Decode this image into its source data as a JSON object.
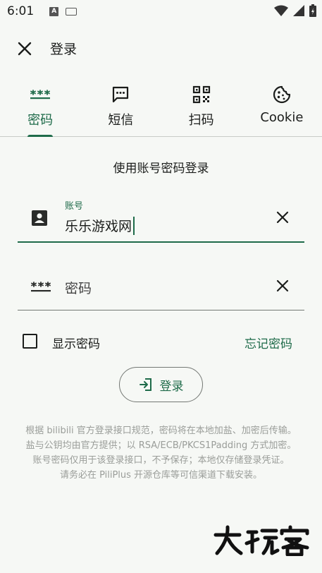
{
  "status_bar": {
    "time": "6:01",
    "notification_icons": [
      "a-notification-icon",
      "keyboard-icon"
    ],
    "right_icons": [
      "wifi-icon",
      "signal-icon",
      "battery-icon"
    ]
  },
  "app_bar": {
    "title": "登录",
    "close_icon": "close-icon"
  },
  "tabs": [
    {
      "label": "密码",
      "icon": "password-dots-icon",
      "active": true
    },
    {
      "label": "短信",
      "icon": "sms-icon",
      "active": false
    },
    {
      "label": "扫码",
      "icon": "qr-code-icon",
      "active": false
    },
    {
      "label": "Cookie",
      "icon": "cookie-icon",
      "active": false
    }
  ],
  "form": {
    "section_title": "使用账号密码登录",
    "account": {
      "label": "账号",
      "value": "乐乐游戏网",
      "icon": "account-box-icon"
    },
    "password": {
      "placeholder": "密码",
      "icon": "password-dots-icon"
    },
    "show_password_label": "显示密码",
    "forgot_password": "忘记密码",
    "login_button": "登录"
  },
  "notes": [
    "根据 bilibili 官方登录接口规范，密码将在本地加盐、加密后传输。",
    "盐与公钥均由官方提供；以 RSA/ECB/PKCS1Padding 方式加密。",
    "账号密码仅用于该登录接口，不予保存；本地仅存储登录凭证。",
    "请务必在 PiliPlus 开源仓库等可信渠道下载安装。"
  ],
  "watermark": "大玩客",
  "colors": {
    "accent": "#1f6b4a",
    "background": "#f6f8f5",
    "note_text": "#9a9d99"
  }
}
